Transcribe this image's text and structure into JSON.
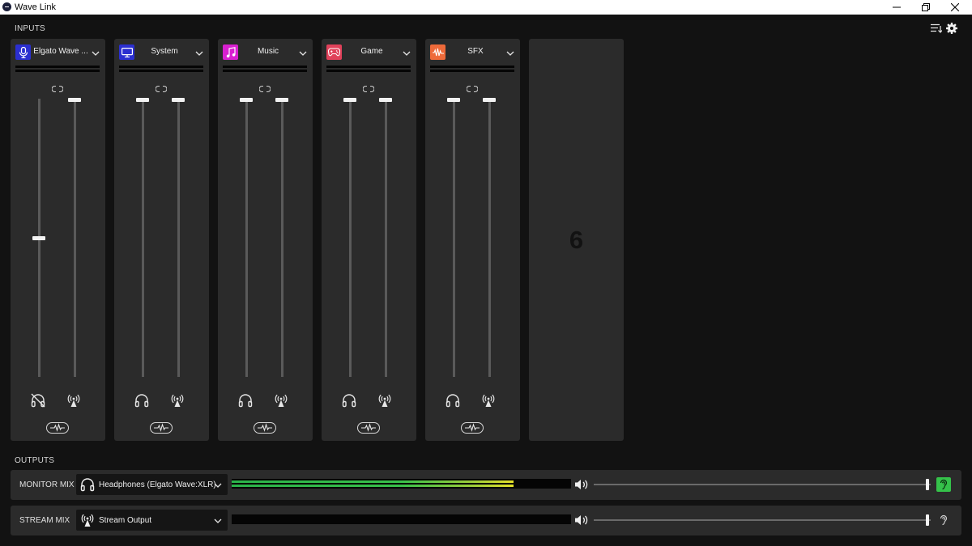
{
  "window": {
    "title": "Wave Link"
  },
  "sections": {
    "inputs": "INPUTS",
    "outputs": "OUTPUTS"
  },
  "inputs": [
    {
      "name": "Elgato Wave ...",
      "icon": "microphone-icon",
      "icon_color": "#2b2fd0",
      "monitor_level": 0.5,
      "stream_level": 1.0,
      "monitor_muted": true
    },
    {
      "name": "System",
      "icon": "monitor-icon",
      "icon_color": "#2b2fd0",
      "monitor_level": 1.0,
      "stream_level": 1.0,
      "monitor_muted": false
    },
    {
      "name": "Music",
      "icon": "music-note-icon",
      "icon_color": "#d81fd0",
      "monitor_level": 1.0,
      "stream_level": 1.0,
      "monitor_muted": false
    },
    {
      "name": "Game",
      "icon": "gamepad-icon",
      "icon_color": "#e0415a",
      "monitor_level": 1.0,
      "stream_level": 1.0,
      "monitor_muted": false
    },
    {
      "name": "SFX",
      "icon": "waveform-icon",
      "icon_color": "#ee6a3a",
      "monitor_level": 1.0,
      "stream_level": 1.0,
      "monitor_muted": false
    }
  ],
  "empty_slot": {
    "number": "6"
  },
  "outputs": [
    {
      "label": "MONITOR MIX",
      "device": "Headphones (Elgato Wave:XLR)",
      "device_icon": "headphones-icon",
      "level": 0.83,
      "volume": 1.0,
      "listening": true,
      "accent": "#35c24a"
    },
    {
      "label": "STREAM MIX",
      "device": "Stream Output",
      "device_icon": "broadcast-icon",
      "level": 0.0,
      "volume": 1.0,
      "listening": false,
      "accent": "#2b2b2b"
    }
  ]
}
